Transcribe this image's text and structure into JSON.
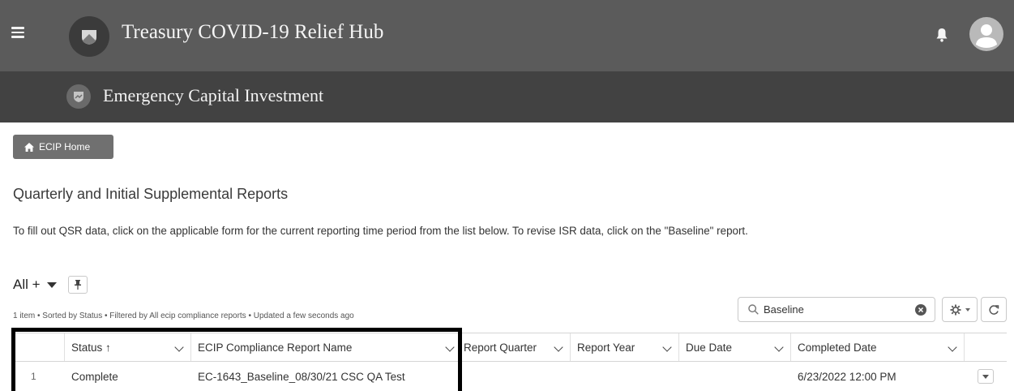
{
  "header": {
    "title": "Treasury COVID-19 Relief Hub",
    "subtitle": "Emergency Capital Investment"
  },
  "home_button": {
    "label": "ECIP Home"
  },
  "page": {
    "section_title": "Quarterly and Initial Supplemental Reports",
    "instructions": "To fill out QSR data, click on the applicable form for the current reporting time period from the list below. To revise ISR data, click on the \"Baseline\" report."
  },
  "list_view": {
    "name": "All +",
    "meta": "1 item • Sorted by Status • Filtered by All ecip compliance reports • Updated a few seconds ago"
  },
  "search": {
    "value": "Baseline"
  },
  "table": {
    "columns": [
      "Status ↑",
      "ECIP Compliance Report Name",
      "Report Quarter",
      "Report Year",
      "Due Date",
      "Completed Date"
    ],
    "rows": [
      {
        "num": "1",
        "status": "Complete",
        "name": "EC-1643_Baseline_08/30/21 CSC QA Test",
        "quarter": "",
        "year": "",
        "due_date": "",
        "completed_date": "6/23/2022 12:00 PM"
      }
    ]
  },
  "colors": {
    "topbar": "#5b5b5b",
    "subbar": "#424242",
    "home_button": "#707070",
    "highlight": "#000000"
  },
  "icons": [
    "hamburger-icon",
    "shield-logo-icon",
    "bell-icon",
    "avatar-icon",
    "home-icon",
    "pin-icon",
    "search-icon",
    "clear-icon",
    "gear-icon",
    "refresh-icon"
  ]
}
